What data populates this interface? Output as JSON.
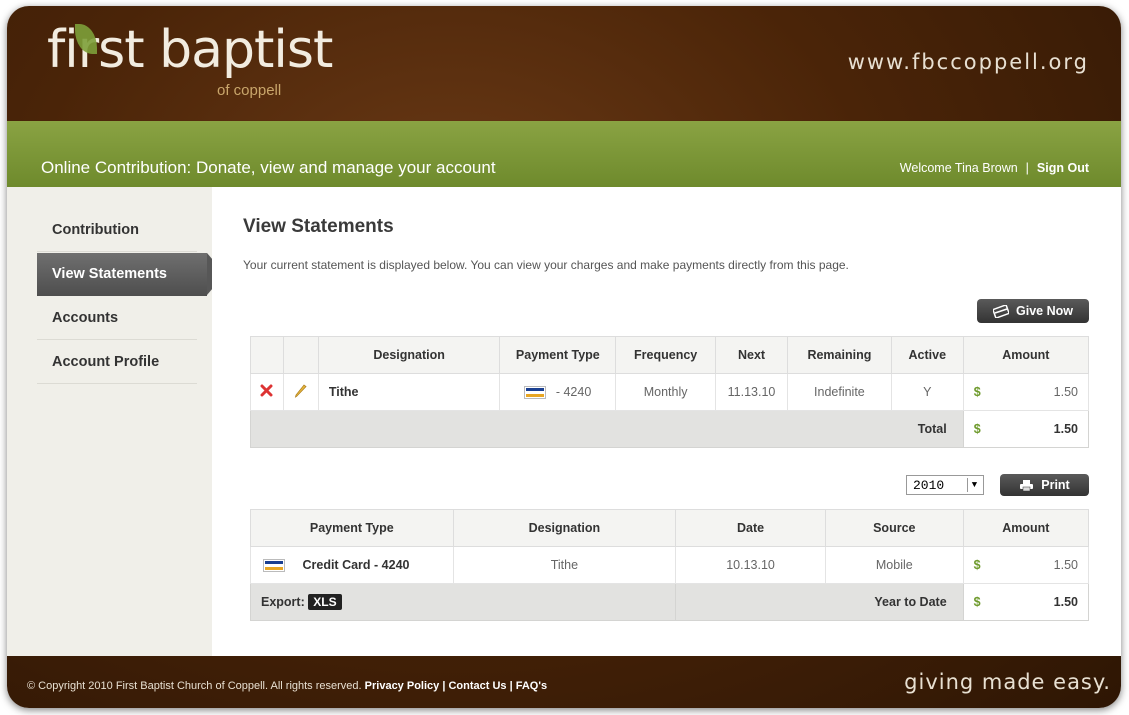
{
  "header": {
    "logo_main": "first baptist",
    "logo_sub": "of coppell",
    "site_url": "www.fbccoppell.org"
  },
  "greenbar": {
    "title": "Online Contribution: Donate, view and manage your account",
    "welcome": "Welcome Tina Brown",
    "separator": "|",
    "sign_out": "Sign Out"
  },
  "sidebar": {
    "items": [
      {
        "label": "Contribution"
      },
      {
        "label": "View Statements"
      },
      {
        "label": "Accounts"
      },
      {
        "label": "Account Profile"
      }
    ],
    "active_index": 1
  },
  "main": {
    "title": "View Statements",
    "description": "Your current statement is displayed below. You can view your charges and make payments directly from this page.",
    "give_now_label": "Give Now",
    "print_label": "Print",
    "year_selected": "2010"
  },
  "schedule_table": {
    "headers": [
      "Designation",
      "Payment Type",
      "Frequency",
      "Next",
      "Remaining",
      "Active",
      "Amount"
    ],
    "rows": [
      {
        "designation": "Tithe",
        "payment_type": "- 4240",
        "frequency": "Monthly",
        "next": "11.13.10",
        "remaining": "Indefinite",
        "active": "Y",
        "currency": "$",
        "amount": "1.50"
      }
    ],
    "total_label": "Total",
    "total_currency": "$",
    "total_amount": "1.50"
  },
  "history_table": {
    "headers": [
      "Payment Type",
      "Designation",
      "Date",
      "Source",
      "Amount"
    ],
    "rows": [
      {
        "payment_type": "Credit Card - 4240",
        "designation": "Tithe",
        "date": "10.13.10",
        "source": "Mobile",
        "currency": "$",
        "amount": "1.50"
      }
    ],
    "export_label": "Export:",
    "export_format": "XLS",
    "ytd_label": "Year to Date",
    "ytd_currency": "$",
    "ytd_amount": "1.50"
  },
  "footer": {
    "copyright": "© Copyright 2010 First Baptist Church of Coppell. All rights reserved.",
    "links": [
      "Privacy Policy",
      "Contact Us",
      "FAQ's"
    ],
    "tagline": "giving made easy."
  },
  "colors": {
    "brand_brown": "#4a2408",
    "brand_green": "#7a9636",
    "dollar_green": "#6e9a2c"
  }
}
